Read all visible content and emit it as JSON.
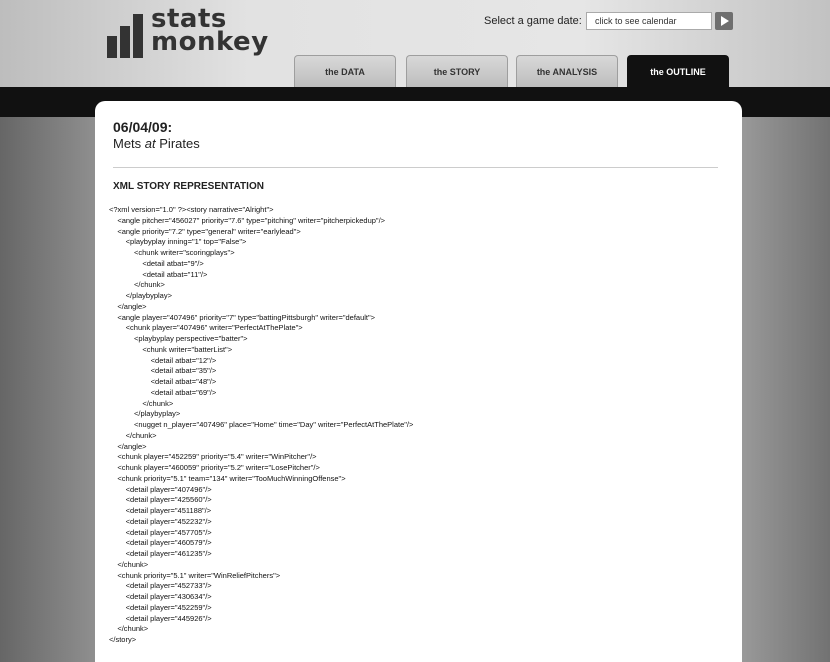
{
  "header": {
    "logo_line1": "stats",
    "logo_line2": "monkey",
    "date_label": "Select a game date:",
    "date_placeholder": "click to see calendar"
  },
  "tabs": [
    {
      "label": "the DATA"
    },
    {
      "label": "the STORY"
    },
    {
      "label": "the ANALYSIS"
    },
    {
      "label": "the OUTLINE"
    }
  ],
  "game": {
    "date": "06/04/09:",
    "matchup_home": "Mets",
    "matchup_at": "at",
    "matchup_away": "Pirates"
  },
  "section_title": "XML STORY REPRESENTATION",
  "xml_lines": [
    "<?xml version=\"1.0\" ?><story narrative=\"Alright\">",
    "    <angle pitcher=\"456027\" priority=\"7.6\" type=\"pitching\" writer=\"pitcherpickedup\"/>",
    "    <angle priority=\"7.2\" type=\"general\" writer=\"earlylead\">",
    "        <playbyplay inning=\"1\" top=\"False\">",
    "            <chunk writer=\"scoringplays\">",
    "                <detail atbat=\"9\"/>",
    "                <detail atbat=\"11\"/>",
    "            </chunk>",
    "        </playbyplay>",
    "    </angle>",
    "    <angle player=\"407496\" priority=\"7\" type=\"battingPittsburgh\" writer=\"default\">",
    "        <chunk player=\"407496\" writer=\"PerfectAtThePlate\">",
    "            <playbyplay perspective=\"batter\">",
    "                <chunk writer=\"batterList\">",
    "                    <detail atbat=\"12\"/>",
    "                    <detail atbat=\"35\"/>",
    "                    <detail atbat=\"48\"/>",
    "                    <detail atbat=\"69\"/>",
    "                </chunk>",
    "            </playbyplay>",
    "            <nugget n_player=\"407496\" place=\"Home\" time=\"Day\" writer=\"PerfectAtThePlate\"/>",
    "        </chunk>",
    "    </angle>",
    "    <chunk player=\"452259\" priority=\"5.4\" writer=\"WinPitcher\"/>",
    "    <chunk player=\"460059\" priority=\"5.2\" writer=\"LosePitcher\"/>",
    "    <chunk priority=\"5.1\" team=\"134\" writer=\"TooMuchWinningOffense\">",
    "        <detail player=\"407496\"/>",
    "        <detail player=\"425560\"/>",
    "        <detail player=\"451188\"/>",
    "        <detail player=\"452232\"/>",
    "        <detail player=\"457705\"/>",
    "        <detail player=\"460579\"/>",
    "        <detail player=\"461235\"/>",
    "    </chunk>",
    "    <chunk priority=\"5.1\" writer=\"WinReliefPitchers\">",
    "        <detail player=\"452733\"/>",
    "        <detail player=\"430634\"/>",
    "        <detail player=\"452259\"/>",
    "        <detail player=\"445926\"/>",
    "    </chunk>",
    "</story>"
  ],
  "colors": {
    "active_tab": "#111111",
    "header_bar": "#111111",
    "panel_bg": "#ffffff"
  }
}
